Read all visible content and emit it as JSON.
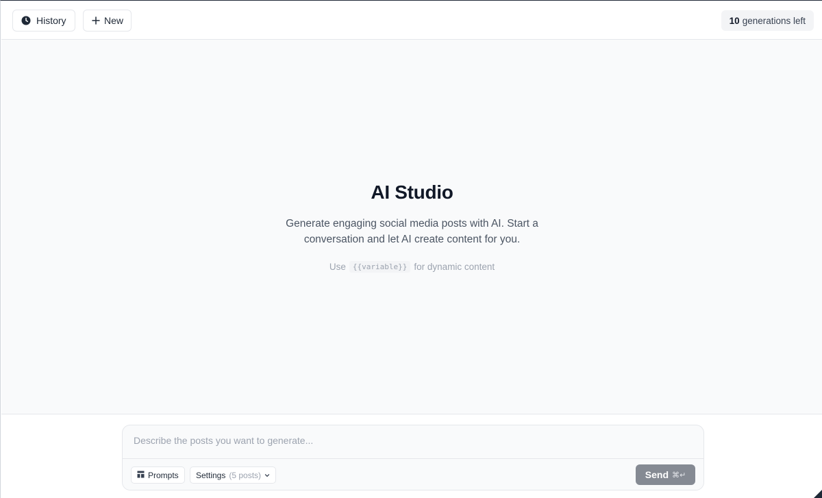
{
  "header": {
    "history_label": "History",
    "new_label": "New",
    "generations_count": "10",
    "generations_suffix": "generations left"
  },
  "hero": {
    "title": "AI Studio",
    "description": "Generate engaging social media posts with AI. Start a conversation and let AI create content for you.",
    "hint_prefix": "Use",
    "hint_code": "{{variable}}",
    "hint_suffix": "for dynamic content"
  },
  "composer": {
    "placeholder": "Describe the posts you want to generate...",
    "prompts_label": "Prompts",
    "settings_label": "Settings",
    "settings_detail": "(5 posts)",
    "send_label": "Send",
    "send_shortcut": "⌘↵"
  },
  "icons": {
    "history": "clock-icon",
    "new": "plus-icon",
    "prompts": "template-icon",
    "settings": "chevron-down-icon"
  },
  "colors": {
    "send_bg": "#858a93",
    "page_bg": "#f9fafb",
    "border": "#e5e7eb"
  }
}
